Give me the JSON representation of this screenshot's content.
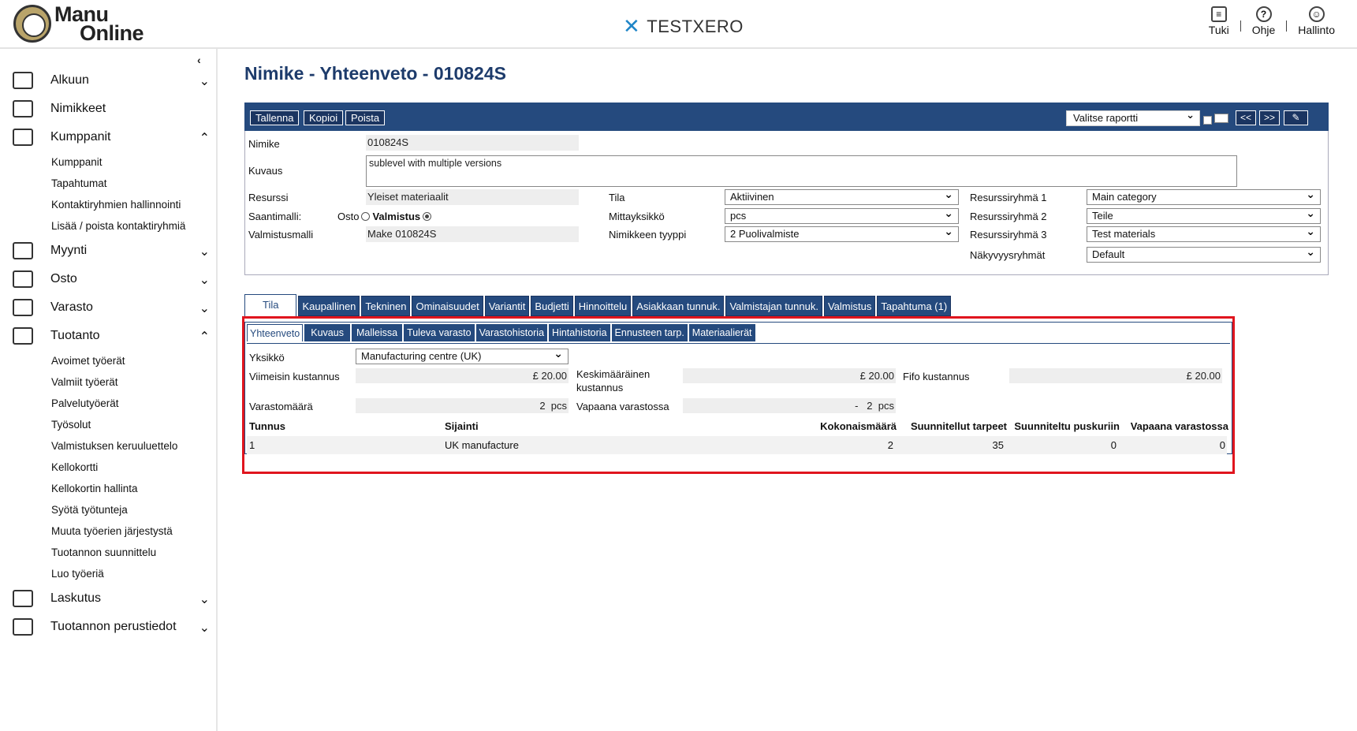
{
  "header": {
    "logo_line1": "Manu",
    "logo_line2": "Online",
    "brand": "TESTXERO",
    "actions": [
      {
        "label": "Tuki",
        "icon": "chat-icon"
      },
      {
        "label": "Ohje",
        "icon": "help-icon"
      },
      {
        "label": "Hallinto",
        "icon": "user-icon"
      }
    ]
  },
  "sidebar": {
    "items": [
      {
        "label": "Alkuun",
        "icon": "home-icon",
        "expanded": false
      },
      {
        "label": "Nimikkeet",
        "icon": "inbox-icon"
      },
      {
        "label": "Kumppanit",
        "icon": "contacts-icon",
        "expanded": true,
        "subs": [
          "Kumppanit",
          "Tapahtumat",
          "Kontaktiryhmien hallinnointi",
          "Lisää / poista kontaktiryhmiä"
        ]
      },
      {
        "label": "Myynti",
        "icon": "wallet-icon",
        "expanded": false
      },
      {
        "label": "Osto",
        "icon": "basket-icon",
        "expanded": false
      },
      {
        "label": "Varasto",
        "icon": "warehouse-icon",
        "expanded": false
      },
      {
        "label": "Tuotanto",
        "icon": "database-icon",
        "expanded": true,
        "subs": [
          "Avoimet työerät",
          "Valmiit työerät",
          "Palvelutyöerät",
          "Työsolut",
          "Valmistuksen keruuluettelo",
          "Kellokortti",
          "Kellokortin hallinta",
          "Syötä työtunteja",
          "Muuta työerien järjestystä",
          "Tuotannon suunnittelu",
          "Luo työeriä"
        ]
      },
      {
        "label": "Laskutus",
        "icon": "document-icon",
        "expanded": false
      },
      {
        "label": "Tuotannon perustiedot",
        "icon": "exit-icon",
        "expanded": false
      }
    ]
  },
  "page": {
    "title": "Nimike - Yhteenveto - 010824S",
    "toolbar": {
      "save": "Tallenna",
      "copy": "Kopioi",
      "delete": "Poista",
      "report_select": "Valitse raportti",
      "prev": "<<",
      "next": ">>"
    },
    "form": {
      "nimike_label": "Nimike",
      "nimike_value": "010824S",
      "kuvaus_label": "Kuvaus",
      "kuvaus_value": "sublevel with multiple versions",
      "resurssi_label": "Resurssi",
      "resurssi_value": "Yleiset materiaalit",
      "saantimalli_label": "Saantimalli:",
      "osto_label": "Osto",
      "valmistus_label": "Valmistus",
      "valmistusmalli_label": "Valmistusmalli",
      "valmistusmalli_value": "Make 010824S",
      "tila_label": "Tila",
      "tila_value": "Aktiivinen",
      "mittayksikko_label": "Mittayksikkö",
      "mittayksikko_value": "pcs",
      "tyyppi_label": "Nimikkeen tyyppi",
      "tyyppi_value": "2 Puolivalmiste",
      "rr1_label": "Resurssiryhmä 1",
      "rr1_value": "Main category",
      "rr2_label": "Resurssiryhmä 2",
      "rr2_value": "Teile",
      "rr3_label": "Resurssiryhmä 3",
      "rr3_value": "Test materials",
      "nak_label": "Näkyvyysryhmät",
      "nak_value": "Default"
    },
    "tabs": [
      "Tila",
      "Kaupallinen",
      "Tekninen",
      "Ominaisuudet",
      "Variantit",
      "Budjetti",
      "Hinnoittelu",
      "Asiakkaan tunnuk.",
      "Valmistajan tunnuk.",
      "Valmistus",
      "Tapahtuma (1)"
    ],
    "subtabs": [
      "Yhteenveto",
      "Kuvaus",
      "Malleissa",
      "Tuleva varasto",
      "Varastohistoria",
      "Hintahistoria",
      "Ennusteen tarp.",
      "Materiaalierät"
    ],
    "summary": {
      "yksikko_label": "Yksikkö",
      "yksikko_value": "Manufacturing centre (UK)",
      "viimeisin_label": "Viimeisin kustannus",
      "viimeisin_value": "£ 20.00",
      "keskimaarainen_label1": "Keskimääräinen",
      "keskimaarainen_label2": "kustannus",
      "keskimaarainen_value": "£ 20.00",
      "fifo_label": "Fifo kustannus",
      "fifo_value": "£ 20.00",
      "varastomaara_label": "Varastomäärä",
      "varastomaara_value": "2  pcs",
      "vapaana_label": "Vapaana varastossa",
      "vapaana_value": "-   2  pcs"
    },
    "table": {
      "headers": [
        "Tunnus",
        "Sijainti",
        "Kokonaismäärä",
        "Suunnitellut tarpeet",
        "Suunniteltu puskuriin",
        "Vapaana varastossa"
      ],
      "rows": [
        [
          "1",
          "UK manufacture",
          "2",
          "35",
          "0",
          "0"
        ]
      ]
    }
  }
}
